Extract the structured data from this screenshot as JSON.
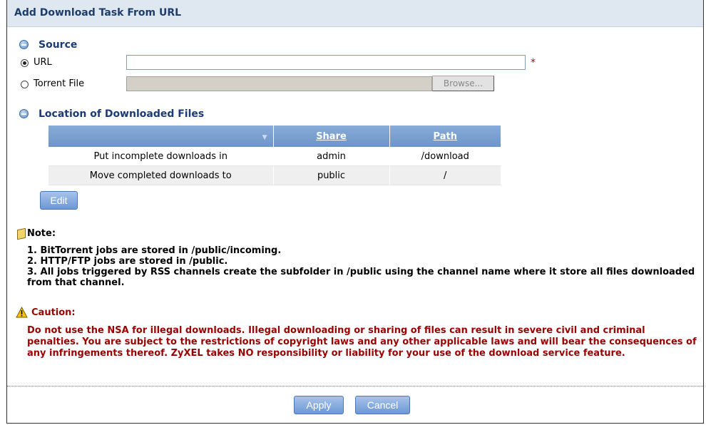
{
  "title": "Add Download Task From URL",
  "source": {
    "heading": "Source",
    "url_label": "URL",
    "url_value": "",
    "url_selected": true,
    "required_mark": "*",
    "torrent_label": "Torrent File",
    "torrent_value": "",
    "browse_label": "Browse..."
  },
  "location": {
    "heading": "Location of Downloaded Files",
    "sort_indicator": "▼",
    "columns": [
      "Share",
      "Path"
    ],
    "rows": [
      {
        "label": "Put incomplete downloads in",
        "share": "admin",
        "path": "/download"
      },
      {
        "label": "Move completed downloads to",
        "share": "public",
        "path": "/"
      }
    ],
    "edit_label": "Edit"
  },
  "note": {
    "heading": "Note:",
    "items": [
      "1. BitTorrent jobs are stored in /public/incoming.",
      "2. HTTP/FTP jobs are stored in /public.",
      "3. All jobs triggered by RSS channels create the subfolder in /public using the channel name where it store all files downloaded from that channel."
    ]
  },
  "caution": {
    "heading": "Caution:",
    "text": "Do not use the NSA for illegal downloads. Illegal downloading or sharing of files can result in severe civil and criminal penalties. You are subject to the restrictions of copyright laws and any other applicable laws and will bear the consequences of any infringements thereof. ZyXEL takes NO responsibility or liability for your use of the download service feature."
  },
  "buttons": {
    "apply": "Apply",
    "cancel": "Cancel"
  },
  "colors": {
    "title_bg": "#dfe7f1",
    "section_title": "#1b3a77",
    "table_header": "#7a9fd0",
    "button": "#7fa6dc",
    "caution_text": "#9b0000",
    "required": "#cc0000"
  }
}
